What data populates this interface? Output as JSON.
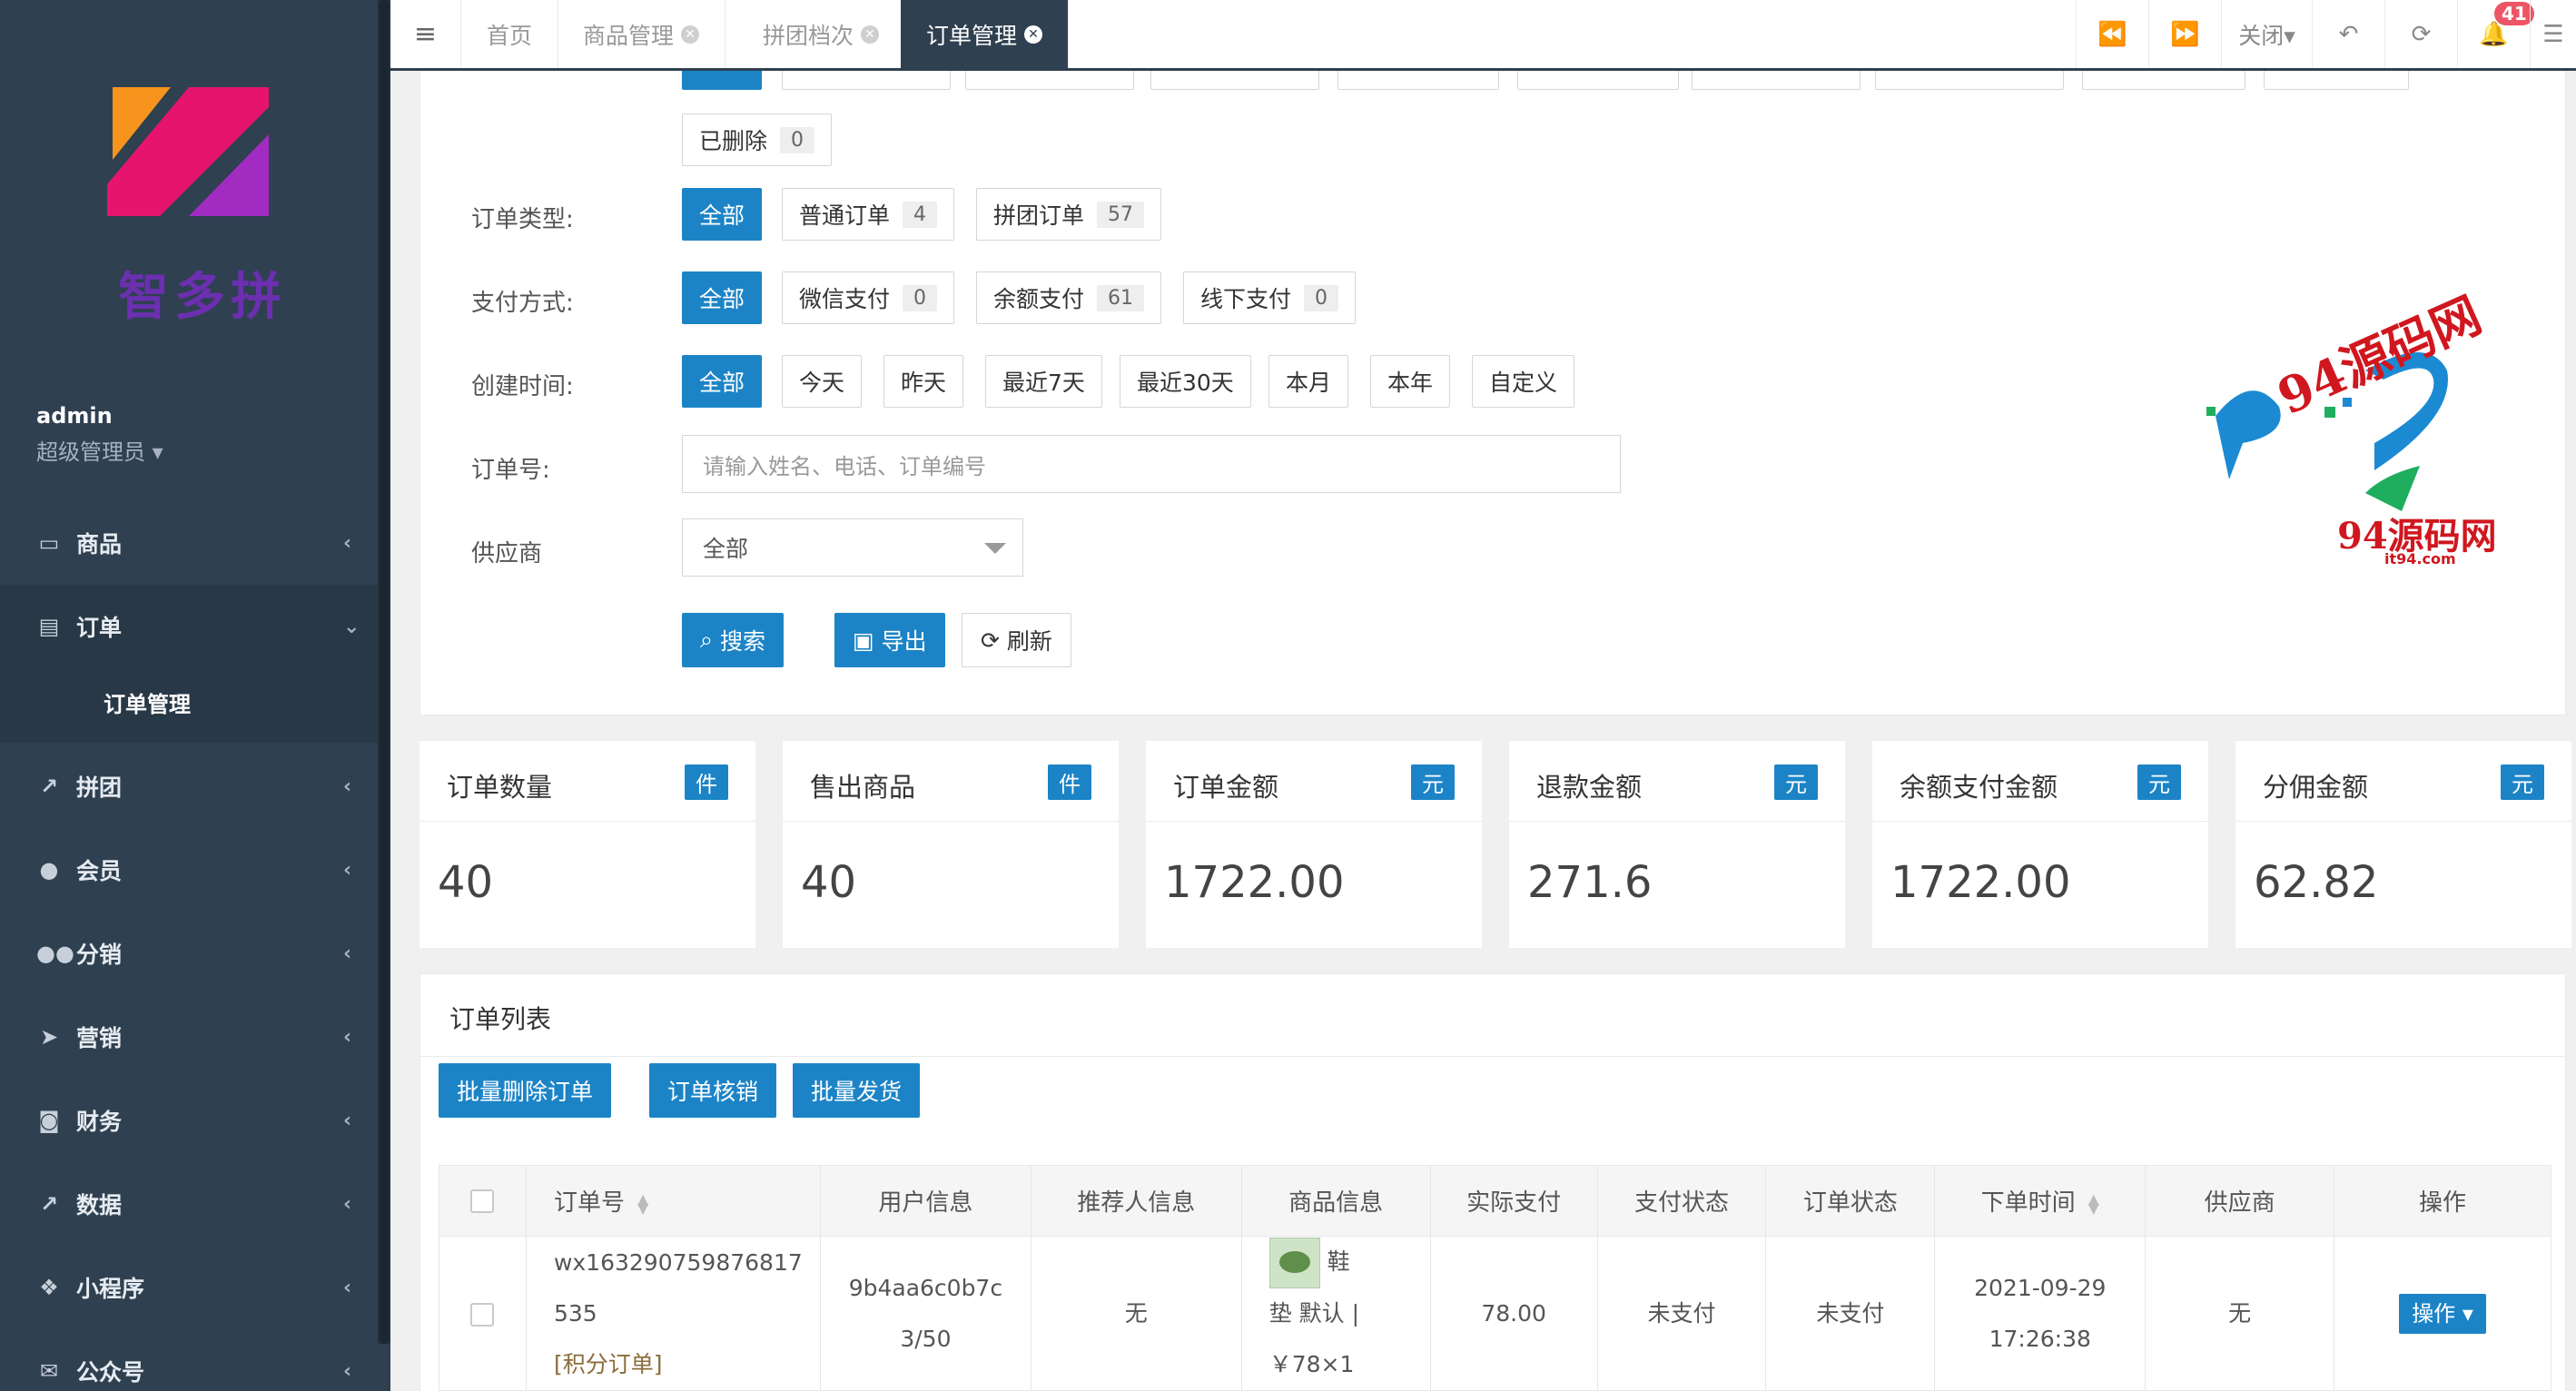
{
  "sidebar": {
    "logo_text": "智多拼",
    "user_name": "admin",
    "user_role": "超级管理员 ▾",
    "items": [
      {
        "label": "商品",
        "icon": "laptop-icon"
      },
      {
        "label": "订单",
        "icon": "receipt-icon"
      },
      {
        "label": "订单管理",
        "icon": ""
      },
      {
        "label": "拼团",
        "icon": "line-chart-icon"
      },
      {
        "label": "会员",
        "icon": "user-icon"
      },
      {
        "label": "分销",
        "icon": "users-icon"
      },
      {
        "label": "营销",
        "icon": "paper-plane-icon"
      },
      {
        "label": "财务",
        "icon": "money-icon"
      },
      {
        "label": "数据",
        "icon": "area-chart-icon"
      },
      {
        "label": "小程序",
        "icon": "cubes-icon"
      },
      {
        "label": "公众号",
        "icon": "wechat-icon"
      }
    ]
  },
  "topbar": {
    "tabs": [
      "首页",
      "商品管理",
      "拼团档次",
      "订单管理"
    ],
    "close_label": "关闭▾",
    "notification_count": "41"
  },
  "filters": {
    "deleted_label": "已删除",
    "deleted_count": "0",
    "order_type_label": "订单类型:",
    "order_types": [
      {
        "label": "全部",
        "count": ""
      },
      {
        "label": "普通订单",
        "count": "4"
      },
      {
        "label": "拼团订单",
        "count": "57"
      }
    ],
    "pay_label": "支付方式:",
    "pay_types": [
      {
        "label": "全部",
        "count": ""
      },
      {
        "label": "微信支付",
        "count": "0"
      },
      {
        "label": "余额支付",
        "count": "61"
      },
      {
        "label": "线下支付",
        "count": "0"
      }
    ],
    "time_label": "创建时间:",
    "time_options": [
      "全部",
      "今天",
      "昨天",
      "最近7天",
      "最近30天",
      "本月",
      "本年",
      "自定义"
    ],
    "order_no_label": "订单号:",
    "order_no_placeholder": "请输入姓名、电话、订单编号",
    "supplier_label": "供应商",
    "supplier_value": "全部",
    "search_button": "搜索",
    "export_button": "导出",
    "refresh_button": "刷新"
  },
  "stats": [
    {
      "title": "订单数量",
      "badge": "件",
      "value": "40"
    },
    {
      "title": "售出商品",
      "badge": "件",
      "value": "40"
    },
    {
      "title": "订单金额",
      "badge": "元",
      "value": "1722.00"
    },
    {
      "title": "退款金额",
      "badge": "元",
      "value": "271.6"
    },
    {
      "title": "余额支付金额",
      "badge": "元",
      "value": "1722.00"
    },
    {
      "title": "分佣金额",
      "badge": "元",
      "value": "62.82"
    }
  ],
  "order_list": {
    "title": "订单列表",
    "bulk_delete": "批量删除订单",
    "verify": "订单核销",
    "bulk_ship": "批量发货",
    "columns": [
      "订单号",
      "用户信息",
      "推荐人信息",
      "商品信息",
      "实际支付",
      "支付状态",
      "订单状态",
      "下单时间",
      "供应商",
      "操作"
    ],
    "rows": [
      {
        "order_no_1": "wx163290759876817",
        "order_no_2": "535",
        "order_tag": "[积分订单]",
        "user_1": "9b4aa6c0b7c",
        "user_2": "3/50",
        "referrer": "无",
        "product_1": "鞋",
        "product_2": "垫 默认 |",
        "product_3": "￥78×1",
        "paid": "78.00",
        "pay_status": "未支付",
        "order_status": "未支付",
        "date": "2021-09-29",
        "time": "17:26:38",
        "supplier": "无",
        "action": "操作 ▾"
      }
    ]
  },
  "watermark": {
    "text_1": "94源码网",
    "text_2": "94源码网",
    "sub": "it94.com"
  },
  "colors": {
    "sidebar": "#2f4050",
    "primary": "#1c84c6",
    "danger": "#ed5565"
  }
}
